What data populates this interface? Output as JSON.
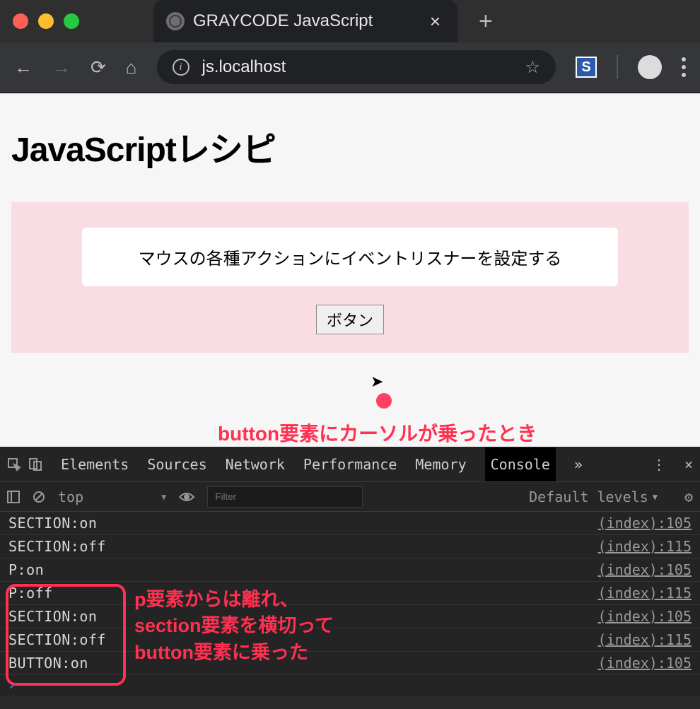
{
  "tab": {
    "title": "GRAYCODE JavaScript"
  },
  "address": {
    "url": "js.localhost"
  },
  "page": {
    "heading": "JavaScriptレシピ",
    "box_text": "マウスの各種アクションにイベントリスナーを設定する",
    "button_label": "ボタン"
  },
  "annotation1": "button要素にカーソルが乗ったとき",
  "annotation2_l1": "p要素からは離れ、",
  "annotation2_l2": "section要素を横切って",
  "annotation2_l3": "button要素に乗った",
  "devtools": {
    "tabs": [
      "Elements",
      "Sources",
      "Network",
      "Performance",
      "Memory",
      "Console"
    ],
    "more": "»",
    "context": "top",
    "filter_placeholder": "Filter",
    "levels": "Default levels",
    "logs": [
      {
        "msg": "SECTION:on",
        "src": "(index):105"
      },
      {
        "msg": "SECTION:off",
        "src": "(index):115"
      },
      {
        "msg": "P:on",
        "src": "(index):105"
      },
      {
        "msg": "P:off",
        "src": "(index):115"
      },
      {
        "msg": "SECTION:on",
        "src": "(index):105"
      },
      {
        "msg": "SECTION:off",
        "src": "(index):115"
      },
      {
        "msg": "BUTTON:on",
        "src": "(index):105"
      }
    ]
  }
}
